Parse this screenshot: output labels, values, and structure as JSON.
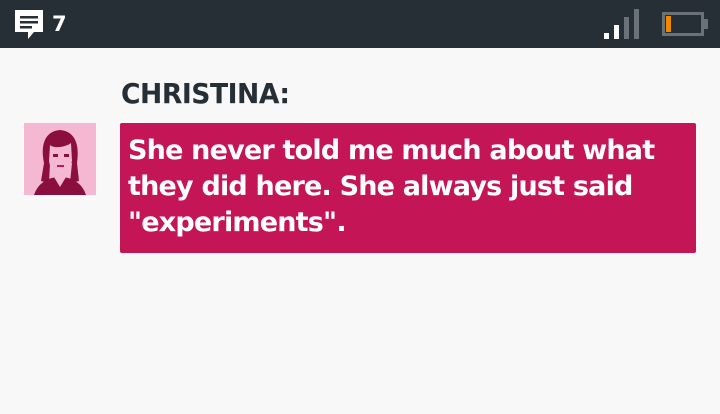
{
  "status_bar": {
    "message_icon": "chat-bubble-icon",
    "message_count": "7",
    "signal_icon": "signal-strength-icon",
    "battery_icon": "battery-low-icon",
    "colors": {
      "background": "#262e36",
      "battery_level": "#f08a00"
    }
  },
  "dialog": {
    "speaker": "CHRISTINA:",
    "avatar_icon": "christina-portrait-icon",
    "message": "She never told me much about what they did here. She always just said \"experiments\".",
    "colors": {
      "bubble": "#c41656",
      "avatar_bg": "#f5b8d2",
      "name": "#262e36"
    }
  }
}
